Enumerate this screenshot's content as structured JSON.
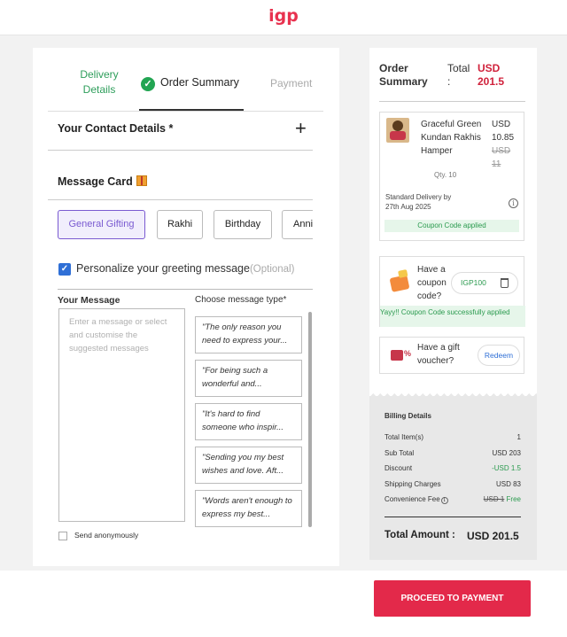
{
  "header": {
    "logo": "igp"
  },
  "steps": {
    "delivery": "Delivery Details",
    "order_summary": "Order Summary",
    "payment": "Payment",
    "check_glyph": "✓"
  },
  "contact": {
    "title": "Your Contact Details *",
    "expand_glyph": "+"
  },
  "message_card": {
    "title": "Message Card",
    "chips": [
      "General Gifting",
      "Rakhi",
      "Birthday",
      "Anni"
    ],
    "personalize_label": "Personalize your greeting message",
    "optional_label": "(Optional)",
    "check_glyph": "✓",
    "your_message_label": "Your Message",
    "message_placeholder": "Enter a message or select and customise the suggested messages",
    "choose_label": "Choose message type*",
    "templates": [
      "\"The only reason you need to express your...",
      "\"For being such a wonderful and...",
      "\"It's hard to find someone who inspir...",
      "\"Sending you my best wishes and love. Aft...",
      "\"Words aren't enough to express my best..."
    ],
    "anonymous_label": "Send anonymously"
  },
  "summary": {
    "title": "Order Summary",
    "total_label": "Total :",
    "total_amount": "USD 201.5",
    "item": {
      "name": "Graceful Green Kundan Rakhis Hamper",
      "qty": "Qty. 10",
      "price": "USD 10.85",
      "original_price": "USD 11",
      "delivery_line1": "Standard Delivery by",
      "delivery_line2": "27th Aug 2025",
      "coupon_applied": "Coupon Code applied"
    },
    "coupon": {
      "question": "Have a coupon code?",
      "code": "IGP100",
      "success": "Yayy!! Coupon Code successfully applied"
    },
    "gift_voucher": {
      "question": "Have a gift voucher?",
      "redeem_label": "Redeem"
    }
  },
  "billing": {
    "title": "Billing Details",
    "rows": [
      {
        "label": "Total Item(s)",
        "value": "1"
      },
      {
        "label": "Sub Total",
        "value": "USD 203"
      },
      {
        "label": "Discount",
        "value": "-USD 1.5"
      },
      {
        "label": "Shipping Charges",
        "value": "USD 83"
      },
      {
        "label": "Convenience Fee",
        "value_strike": "USD 1",
        "value": "Free"
      }
    ],
    "total_label": "Total Amount :",
    "total_value": "USD 201.5"
  },
  "footer": {
    "proceed_label": "PROCEED TO PAYMENT"
  },
  "colors": {
    "brand": "#e3294a",
    "success": "#2a9a4e",
    "active_chip": "#7a5ad1"
  }
}
